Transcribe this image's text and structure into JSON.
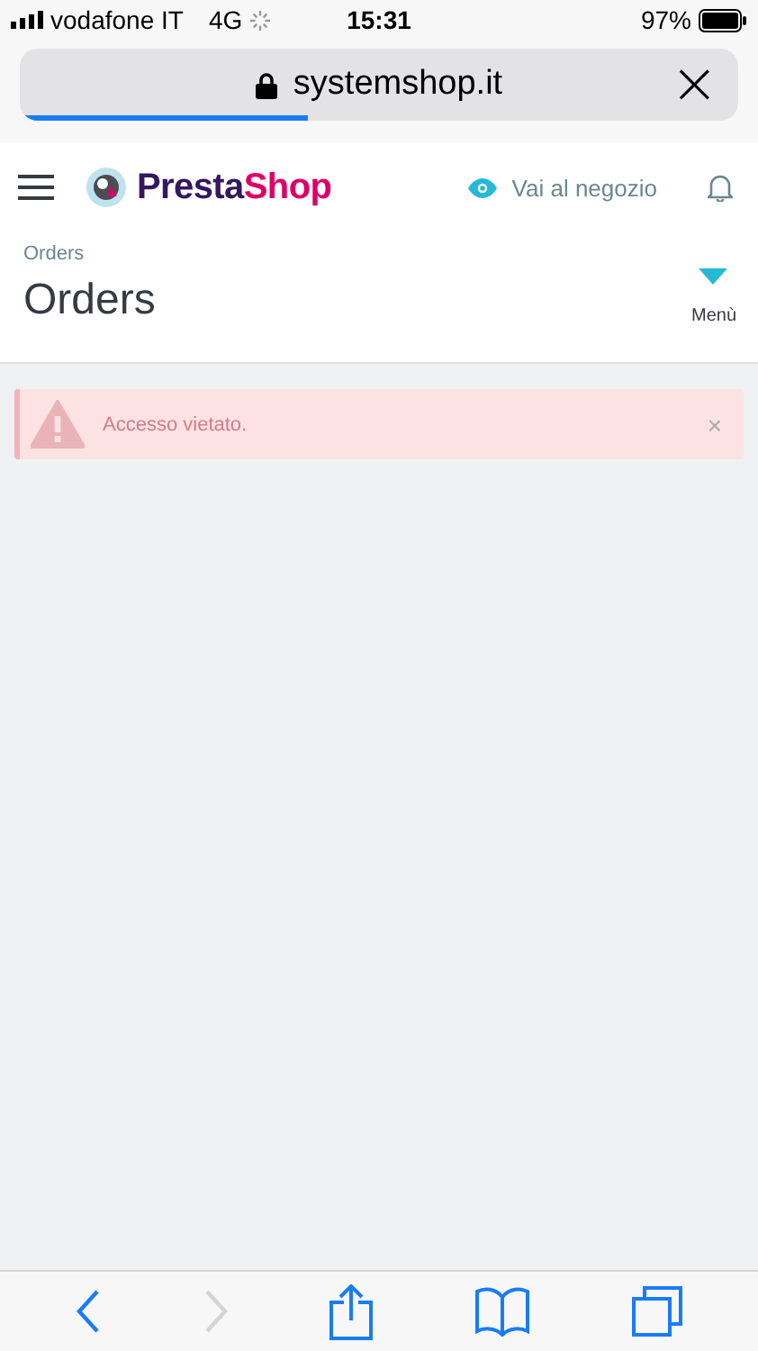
{
  "status_bar": {
    "carrier": "vodafone IT",
    "network": "4G",
    "time": "15:31",
    "battery": "97%"
  },
  "address_bar": {
    "url": "systemshop.it",
    "close": "×",
    "loading": {
      "level": 0.4
    }
  },
  "header": {
    "logo": {
      "first": "Presta",
      "second": "Shop"
    },
    "store_link": "Vai al negozio"
  },
  "page": {
    "breadcrumb": "Orders",
    "title": "Orders",
    "menu_label": "Menù"
  },
  "alert": {
    "message": "Accesso vietato.",
    "close": "×"
  },
  "toolbar": [
    {
      "kind": "back",
      "disabled": false
    },
    {
      "kind": "forward",
      "disabled": true
    },
    {
      "kind": "share",
      "disabled": false
    },
    {
      "kind": "bookmarks",
      "disabled": false
    },
    {
      "kind": "tabs",
      "disabled": false
    }
  ]
}
